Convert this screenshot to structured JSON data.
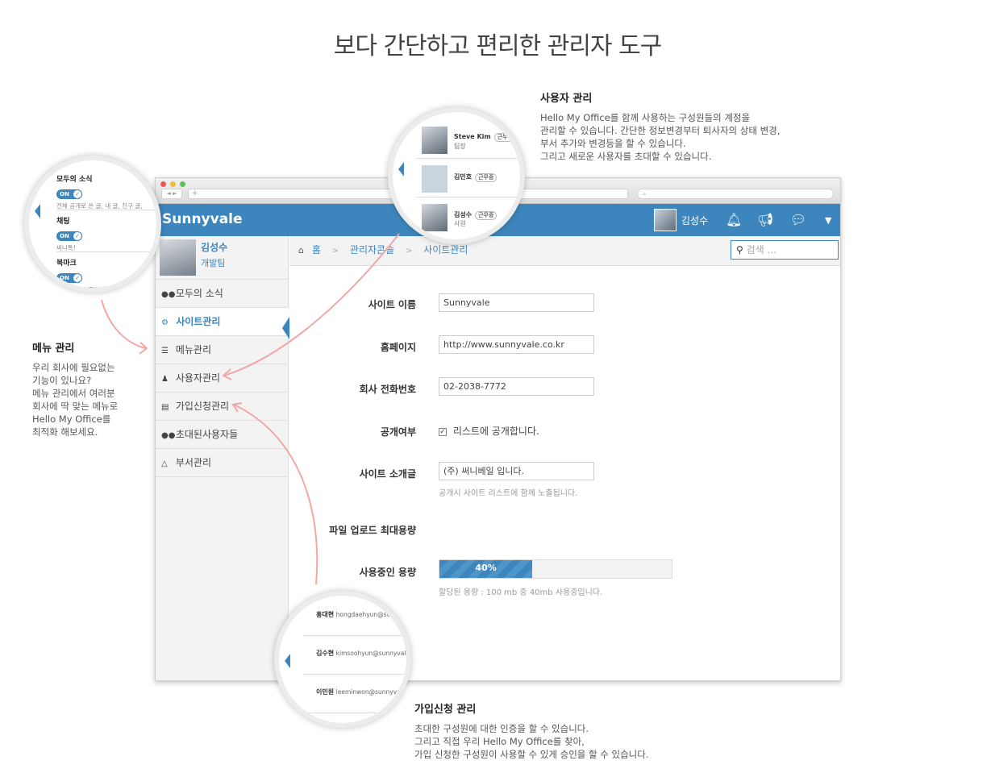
{
  "page_title": "보다 간단하고 편리한 관리자 도구",
  "notes": {
    "user_mgmt": {
      "title": "사용자 관리",
      "body": "Hello My Office를 함께 사용하는 구성원들의 계정을\n관리할 수 있습니다. 간단한 정보변경부터 퇴사자의 상태 변경,\n부서 추가와 변경등을 할 수 있습니다.\n그리고 새로운 사용자를 초대할 수 있습니다."
    },
    "menu_mgmt": {
      "title": "메뉴 관리",
      "body": "우리 회사에 필요없는\n기능이 있나요?\n메뉴 관리에서 여러분\n회사에 딱 맞는 메뉴로\nHello My Office를\n최적화 해보세요."
    },
    "signup_mgmt": {
      "title": "가입신청 관리",
      "body": "초대한 구성원에 대한 인증을 할 수 있습니다.\n그리고 직접 우리 Hello My Office를 찾아,\n가입 신청한 구성원이 사용할 수 있게 승인을 할 수 있습니다."
    }
  },
  "browser": {
    "nav_buttons": "◄ ►",
    "tab_plus": "+",
    "search_icon": "⌕",
    "brand": "Sunnyvale",
    "user_name": "김성수",
    "icons": [
      "bell-icon",
      "megaphone-icon",
      "chat-icon",
      "caret-down-icon"
    ],
    "profile": {
      "name": "김성수",
      "team": "개발팀"
    },
    "menu": [
      {
        "label": "모두의 소식",
        "icon": "users-icon",
        "active": false
      },
      {
        "label": "사이트관리",
        "icon": "gear-icon",
        "active": true
      },
      {
        "label": "메뉴관리",
        "icon": "list-icon",
        "active": false
      },
      {
        "label": "사용자관리",
        "icon": "user-icon",
        "active": false
      },
      {
        "label": "가입신청관리",
        "icon": "card-icon",
        "active": false
      },
      {
        "label": "초대된사용자들",
        "icon": "users-icon",
        "active": false
      },
      {
        "label": "부서관리",
        "icon": "sitemap-icon",
        "active": false
      }
    ],
    "breadcrumb": [
      "홈",
      "관리자콘솔",
      "사이트관리"
    ],
    "search_placeholder": "검색 ...",
    "form": {
      "site_name_label": "사이트 이름",
      "site_name_value": "Sunnyvale",
      "homepage_label": "홈페이지",
      "homepage_value": "http://www.sunnyvale.co.kr",
      "phone_label": "회사 전화번호",
      "phone_value": "02-2038-7772",
      "public_label": "공개여부",
      "public_checkbox": "리스트에 공개합니다.",
      "intro_label": "사이트 소개글",
      "intro_value": "(주) 써니베일 입니다.",
      "intro_help": "공개시 사이트 리스트에 함께 노출됩니다.",
      "upload_label": "파일 업로드 최대용량",
      "usage_label": "사용중인 용량",
      "usage_percent_text": "40%",
      "usage_fraction": 0.4,
      "usage_help": "할당된 용량 : 100 mb 중 40mb 사용중입니다."
    }
  },
  "circle_menu": [
    {
      "title": "모두의 소식",
      "toggle": "ON",
      "desc": "전체 공개로 쓴 글, 내 글, 친구 글,"
    },
    {
      "title": "채팅",
      "toggle": "ON",
      "desc": "써니톡!"
    },
    {
      "title": "북마크",
      "toggle": "ON",
      "desc": "회원 각자가 즐겨찾는 콘"
    }
  ],
  "circle_users": [
    {
      "name": "Steve Kim",
      "role": "팀장",
      "status": "근무중"
    },
    {
      "name": "김민호",
      "role": "",
      "status": "근무중"
    },
    {
      "name": "김성수",
      "role": "사원",
      "status": "근무중"
    }
  ],
  "circle_signups": [
    {
      "name": "홍대현",
      "email": "hongdaehyun@su"
    },
    {
      "name": "김수현",
      "email": "kimsoohyun@sunnyvale"
    },
    {
      "name": "이민원",
      "email": "leeminwon@sunnyva"
    }
  ],
  "colors": {
    "accent": "#3d86bd",
    "arrow": "#f2a7a7"
  }
}
